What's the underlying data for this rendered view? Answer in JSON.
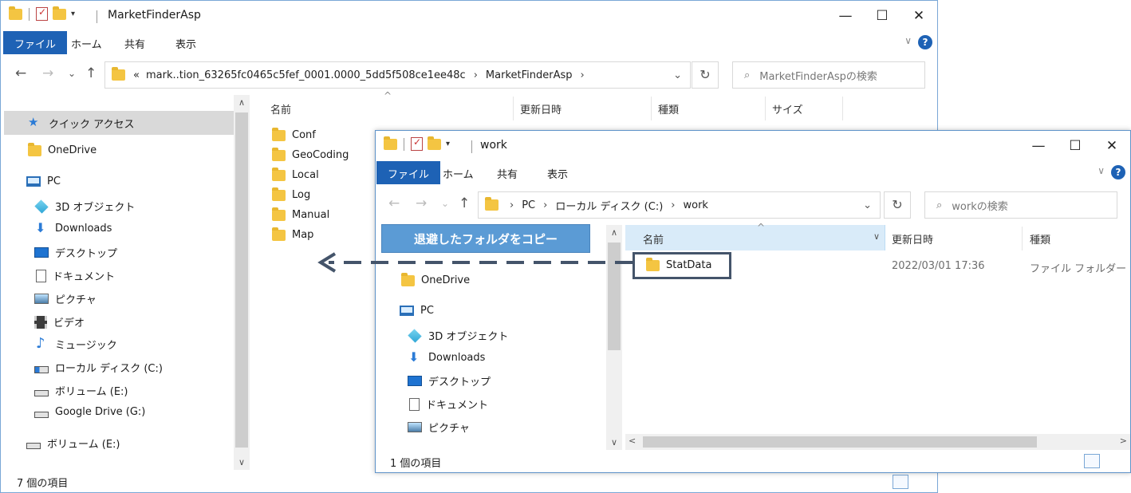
{
  "back_window": {
    "qat_arrow": "▾",
    "title": "MarketFinderAsp",
    "caption": {
      "minimize": "—",
      "maximize": "☐",
      "close": "✕"
    },
    "ribbon": {
      "file": "ファイル",
      "home": "ホーム",
      "share": "共有",
      "view": "表示",
      "collapse": "∨",
      "help": "?"
    },
    "nav": {
      "back": "←",
      "forward": "→",
      "recent": "⌄",
      "up": "↑"
    },
    "address": {
      "overflow": "«",
      "crumbs": [
        "mark..tion_63265fc0465c5fef_0001.0000_5dd5f508ce1ee48c",
        "MarketFinderAsp"
      ],
      "sep": "›",
      "dropdown": "⌄",
      "refresh": "↻"
    },
    "search": {
      "icon": "⌕",
      "placeholder": "MarketFinderAspの検索"
    },
    "sidebar": {
      "quick_access": "クイック アクセス",
      "onedrive": "OneDrive",
      "pc": "PC",
      "obj3d": "3D オブジェクト",
      "downloads": "Downloads",
      "desktop": "デスクトップ",
      "documents": "ドキュメント",
      "pictures": "ピクチャ",
      "videos": "ビデオ",
      "music": "ミュージック",
      "local_disk": "ローカル ディスク (C:)",
      "volume_e": "ボリューム (E:)",
      "google_drive": "Google Drive (G:)",
      "volume_e2": "ボリューム (E:)"
    },
    "scroll": {
      "up": "∧",
      "down": "∨"
    },
    "columns": {
      "sort_arrow": "^",
      "name": "名前",
      "modified": "更新日時",
      "type": "種類",
      "size": "サイズ"
    },
    "files": [
      "Conf",
      "GeoCoding",
      "Local",
      "Log",
      "Manual",
      "Map"
    ],
    "status": "7 個の項目"
  },
  "front_window": {
    "qat_arrow": "▾",
    "title": "work",
    "caption": {
      "minimize": "—",
      "maximize": "☐",
      "close": "✕"
    },
    "ribbon": {
      "file": "ファイル",
      "home": "ホーム",
      "share": "共有",
      "view": "表示",
      "collapse": "∨",
      "help": "?"
    },
    "nav": {
      "back": "←",
      "forward": "→",
      "recent": "⌄",
      "up": "↑"
    },
    "address": {
      "crumbs": [
        "PC",
        "ローカル ディスク (C:)",
        "work"
      ],
      "sep": "›",
      "dropdown": "⌄",
      "refresh": "↻"
    },
    "search": {
      "icon": "⌕",
      "placeholder": "workの検索"
    },
    "sidebar": {
      "onedrive": "OneDrive",
      "pc": "PC",
      "obj3d": "3D オブジェクト",
      "downloads": "Downloads",
      "desktop": "デスクトップ",
      "documents": "ドキュメント",
      "pictures": "ピクチャ"
    },
    "scroll": {
      "up": "∧",
      "down": "∨",
      "left": "<",
      "right": ">"
    },
    "columns": {
      "sort_arrow": "^",
      "name": "名前",
      "name_dropdown": "∨",
      "modified": "更新日時",
      "type": "種類"
    },
    "row": {
      "name": "StatData",
      "modified": "2022/03/01 17:36",
      "type": "ファイル フォルダー"
    },
    "status": "1 個の項目"
  },
  "annotation": {
    "callout": "退避したフォルダをコピー",
    "arrow_color": "#44546a",
    "callout_color": "#5b9bd5"
  }
}
